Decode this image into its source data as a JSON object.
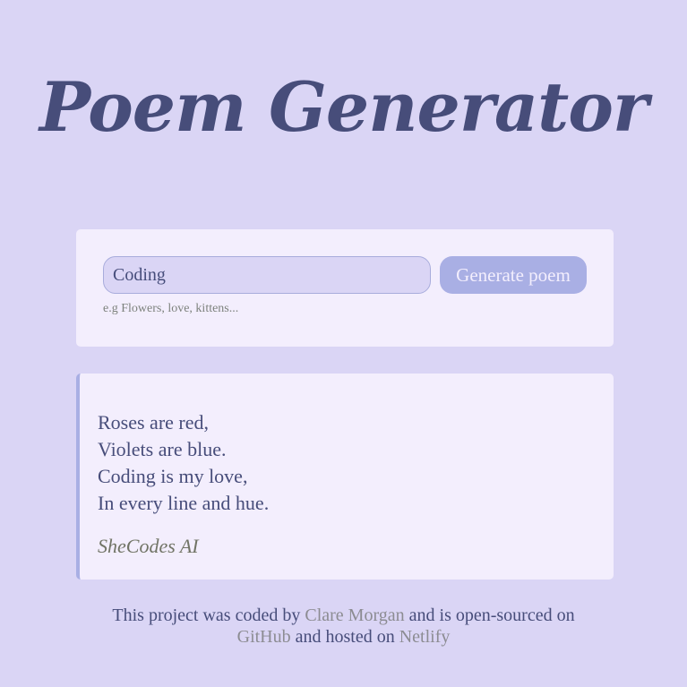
{
  "header": {
    "title": "Poem Generator"
  },
  "form": {
    "input_value": "Coding",
    "button_label": "Generate poem",
    "hint": "e.g Flowers, love, kittens..."
  },
  "poem": {
    "lines": [
      "Roses are red,",
      "Violets are blue.",
      "Coding is my love,",
      "In every line and hue."
    ],
    "signature": "SheCodes AI"
  },
  "footer": {
    "text_1": "This project was coded by ",
    "author_link": "Clare Morgan",
    "text_2": " and is open-sourced on",
    "github_link": "GitHub",
    "text_3": " and hosted on ",
    "netlify_link": "Netlify"
  },
  "colors": {
    "background": "#dad5f5",
    "card": "#f3eefd",
    "accent": "#a9afe4",
    "text": "#474d7a",
    "link": "#8c8c92"
  }
}
